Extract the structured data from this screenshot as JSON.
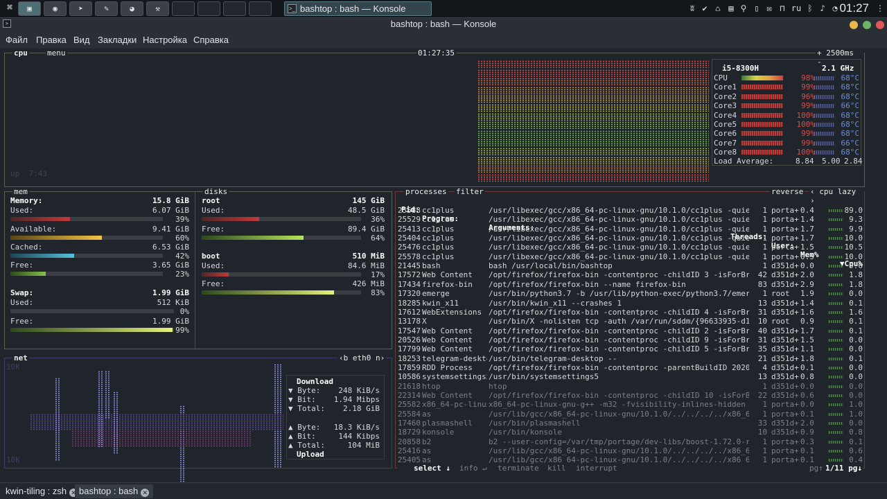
{
  "taskbar": {
    "apps": [
      {
        "name": "konsole-app",
        "glyph": "▣"
      },
      {
        "name": "firefox-app",
        "glyph": "◉"
      },
      {
        "name": "telegram-app",
        "glyph": "➤"
      },
      {
        "name": "podcast-app",
        "glyph": "✎"
      },
      {
        "name": "eye-app",
        "glyph": "◕"
      },
      {
        "name": "tool-app",
        "glyph": "⚒"
      }
    ],
    "active_task": "bashtop : bash — Konsole",
    "tray_lang": "ru",
    "clock": "01:27"
  },
  "window": {
    "title": "bashtop : bash — Konsole",
    "menu": [
      "Файл",
      "Правка",
      "Вид",
      "Закладки",
      "Настройка",
      "Справка"
    ]
  },
  "cpu": {
    "label": "cpu",
    "menu_label": "menu",
    "time": "01:27:35",
    "interval": "+ 2500ms -",
    "uptime": "up  7:43",
    "model": "i5-8300H",
    "freq": "2.1 GHz",
    "cores": [
      {
        "name": "CPU",
        "pct": "98%",
        "temp": "68°C"
      },
      {
        "name": "Core1",
        "pct": "99%",
        "temp": "68°C"
      },
      {
        "name": "Core2",
        "pct": "96%",
        "temp": "68°C"
      },
      {
        "name": "Core3",
        "pct": "99%",
        "temp": "66°C"
      },
      {
        "name": "Core4",
        "pct": "100%",
        "temp": "68°C"
      },
      {
        "name": "Core5",
        "pct": "100%",
        "temp": "68°C"
      },
      {
        "name": "Core6",
        "pct": "99%",
        "temp": "68°C"
      },
      {
        "name": "Core7",
        "pct": "99%",
        "temp": "66°C"
      },
      {
        "name": "Core8",
        "pct": "100%",
        "temp": "68°C"
      }
    ],
    "load_label": "Load Average:",
    "load": [
      "8.84",
      "5.00",
      "2.84"
    ]
  },
  "mem": {
    "label": "mem",
    "memory_label": "Memory:",
    "memory_total": "15.8 GiB",
    "used_label": "Used:",
    "used": "6.07 GiB",
    "used_pct": "39%",
    "used_frac": 0.39,
    "avail_label": "Available:",
    "avail": "9.41 GiB",
    "avail_pct": "60%",
    "avail_frac": 0.6,
    "cached_label": "Cached:",
    "cached": "6.53 GiB",
    "cached_pct": "42%",
    "cached_frac": 0.42,
    "free_label": "Free:",
    "free": "3.65 GiB",
    "free_pct": "23%",
    "free_frac": 0.23,
    "swap_label": "Swap:",
    "swap_total": "1.99 GiB",
    "swap_used_label": "Used:",
    "swap_used": "512 KiB",
    "swap_used_pct": "0%",
    "swap_free_label": "Free:",
    "swap_free": "1.99 GiB",
    "swap_free_pct": "99%",
    "swap_free_frac": 0.99
  },
  "disks": {
    "label": "disks",
    "root_label": "root",
    "root_total": "145 GiB",
    "root_used_label": "Used:",
    "root_used": "48.5 GiB",
    "root_used_pct": "36%",
    "root_used_frac": 0.36,
    "root_free_label": "Free:",
    "root_free": "89.4 GiB",
    "root_free_pct": "64%",
    "root_free_frac": 0.64,
    "boot_label": "boot",
    "boot_total": "510 MiB",
    "boot_used_label": "Used:",
    "boot_used": "84.6 MiB",
    "boot_used_pct": "17%",
    "boot_used_frac": 0.17,
    "boot_free_label": "Free:",
    "boot_free": "426 MiB",
    "boot_free_pct": "83%",
    "boot_free_frac": 0.83
  },
  "net": {
    "label": "net",
    "iface": "‹b eth0 n›",
    "scale_top": "10K",
    "scale_bottom": "10K",
    "download_label": "Download",
    "dl_byte": "▼ Byte:",
    "dl_byte_val": "248 KiB/s",
    "dl_bit": "▼ Bit:",
    "dl_bit_val": "1.94 Mibps",
    "dl_total": "▼ Total:",
    "dl_total_val": "2.18 GiB",
    "ul_byte": "▲ Byte:",
    "ul_byte_val": "18.3 KiB/s",
    "ul_bit": "▲ Bit:",
    "ul_bit_val": "144 Kibps",
    "ul_total": "▲ Total:",
    "ul_total_val": "104 MiB",
    "upload_label": "Upload"
  },
  "proc": {
    "label": "processes",
    "filter_label": "filter",
    "reverse_label": "reverse",
    "sort_label": "‹ cpu lazy ›",
    "headers": {
      "pid": "Pid:",
      "program": "Program:",
      "args": "Arguments:",
      "threads": "Threads:",
      "user": "User:",
      "mem": "Mem%",
      "cpu": "▼Cpu%"
    },
    "rows": [
      [
        "25583",
        "cc1plus",
        "/usr/libexec/gcc/x86_64-pc-linux-gnu/10.1.0/cc1plus -quiet -I .",
        "1",
        "porta+",
        "0.4",
        "89.0"
      ],
      [
        "25529",
        "cc1plus",
        "/usr/libexec/gcc/x86_64-pc-linux-gnu/10.1.0/cc1plus -quiet -I .",
        "1",
        "porta+",
        "1.4",
        "9.3"
      ],
      [
        "25413",
        "cc1plus",
        "/usr/libexec/gcc/x86_64-pc-linux-gnu/10.1.0/cc1plus -quiet -I .",
        "1",
        "porta+",
        "1.7",
        "9.9"
      ],
      [
        "25404",
        "cc1plus",
        "/usr/libexec/gcc/x86_64-pc-linux-gnu/10.1.0/cc1plus -quiet -I .",
        "1",
        "porta+",
        "1.7",
        "10.0"
      ],
      [
        "25476",
        "cc1plus",
        "/usr/libexec/gcc/x86_64-pc-linux-gnu/10.1.0/cc1plus -quiet -I .",
        "1",
        "porta+",
        "1.5",
        "10.5"
      ],
      [
        "25578",
        "cc1plus",
        "/usr/libexec/gcc/x86_64-pc-linux-gnu/10.1.0/cc1plus -quiet -I .",
        "1",
        "porta+",
        "0.5",
        "10.0"
      ],
      [
        "21445",
        "bash",
        "bash /usr/local/bin/bashtop",
        "1",
        "d351d+",
        "0.0",
        "9.6"
      ],
      [
        "17572",
        "Web Content",
        "/opt/firefox/firefox-bin -contentproc -childID 3 -isForBrowser",
        "42",
        "d351d+",
        "2.0",
        "1.8"
      ],
      [
        "17434",
        "firefox-bin",
        "/opt/firefox/firefox-bin --name firefox-bin",
        "83",
        "d351d+",
        "2.9",
        "1.8"
      ],
      [
        "17320",
        "emerge",
        "/usr/bin/python3.7 -b /usr/lib/python-exec/python3.7/emerge -a",
        "1",
        "root",
        "1.9",
        "0.0"
      ],
      [
        "18285",
        "kwin_x11",
        "/usr/bin/kwin_x11 --crashes 1",
        "13",
        "d351d+",
        "1.4",
        "0.1"
      ],
      [
        "17612",
        "WebExtensions",
        "/opt/firefox/firefox-bin -contentproc -childID 4 -isForBrowser",
        "31",
        "d351d+",
        "1.6",
        "1.6"
      ],
      [
        "13178",
        "X",
        "/usr/bin/X -nolisten tcp -auth /var/run/sddm/{96633935-d10c-448",
        "10",
        "root",
        "0.9",
        "0.1"
      ],
      [
        "17547",
        "Web Content",
        "/opt/firefox/firefox-bin -contentproc -childID 2 -isForBrowser",
        "40",
        "d351d+",
        "1.7",
        "0.1"
      ],
      [
        "20526",
        "Web Content",
        "/opt/firefox/firefox-bin -contentproc -childID 9 -isForBrowser",
        "31",
        "d351d+",
        "1.5",
        "0.0"
      ],
      [
        "17799",
        "Web Content",
        "/opt/firefox/firefox-bin -contentproc -childID 5 -isForBrowser",
        "35",
        "d351d+",
        "1.1",
        "0.0"
      ],
      [
        "18253",
        "telegram-deskto",
        "/usr/bin/telegram-desktop --",
        "21",
        "d351d+",
        "1.8",
        "0.1"
      ],
      [
        "17859",
        "RDD Process",
        "/opt/firefox/firefox-bin -contentproc -parentBuildID 2020050711",
        "4",
        "d351d+",
        "0.1",
        "0.0"
      ],
      [
        "10586",
        "systemsettings5",
        "/usr/bin/systemsettings5",
        "13",
        "d351d+",
        "0.8",
        "0.0"
      ],
      [
        "21618",
        "htop",
        "htop",
        "1",
        "d351d+",
        "0.0",
        "0.0"
      ],
      [
        "22314",
        "Web Content",
        "/opt/firefox/firefox-bin -contentproc -childID 10 -isForBrowser",
        "22",
        "d351d+",
        "0.6",
        "0.0"
      ],
      [
        "25582",
        "x86_64-pc-linux",
        "x86_64-pc-linux-gnu-g++ -m32 -fvisibility-inlines-hidden -march",
        "1",
        "porta+",
        "0.0",
        "1.0"
      ],
      [
        "25584",
        "as",
        "/usr/lib/gcc/x86_64-pc-linux-gnu/10.1.0/../../../../x86_64-pc-l",
        "1",
        "porta+",
        "0.1",
        "1.0"
      ],
      [
        "17460",
        "plasmashell",
        "/usr/bin/plasmashell",
        "33",
        "d351d+",
        "2.0",
        "0.0"
      ],
      [
        "18729",
        "konsole",
        "/usr/bin/konsole",
        "10",
        "d351d+",
        "0.9",
        "0.8"
      ],
      [
        "20858",
        "b2",
        "b2 --user-config=/var/tmp/portage/dev-libs/boost-1.72.0-r1/work",
        "1",
        "porta+",
        "0.3",
        "0.1"
      ],
      [
        "25416",
        "as",
        "/usr/lib/gcc/x86_64-pc-linux-gnu/10.1.0/../../../../x86_64-pc-l",
        "1",
        "porta+",
        "0.1",
        "0.6"
      ],
      [
        "25405",
        "as",
        "/usr/lib/gcc/x86_64-pc-linux-gnu/10.1.0/../../../../x86_64-pc-l",
        "1",
        "porta+",
        "0.1",
        "0.4"
      ]
    ],
    "footer": {
      "select": "select ↓",
      "info": "info ↵",
      "terminate": "terminate",
      "kill": "kill",
      "interrupt": "interrupt",
      "pg": "pg↑",
      "page": "1/11 pg↓"
    }
  },
  "tabs": [
    "kwin-tiling : zsh",
    "bashtop : bash"
  ],
  "colors": {
    "accent": "#4f6e73",
    "box": "#5d5f52",
    "temp": "#6a8fd8"
  }
}
